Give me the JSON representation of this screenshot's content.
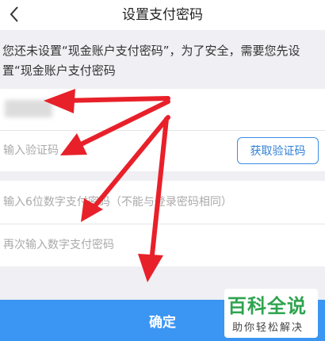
{
  "header": {
    "title": "设置支付密码",
    "back_icon": "chevron-left-icon"
  },
  "notice": {
    "text": "您还未设置“现金账户支付密码”，为了安全，需要您先设置“现金账户支付密码"
  },
  "form": {
    "phone": {
      "value": ""
    },
    "code": {
      "placeholder": "输入验证码",
      "button_label": "获取验证码"
    },
    "password": {
      "placeholder": "输入6位数字支付密码（不能与登录密码相同）"
    },
    "confirm_password": {
      "placeholder": "再次输入数字支付密码"
    }
  },
  "confirm_button": {
    "label": "确定"
  },
  "watermark": {
    "main": "百科全说",
    "sub": "助你轻松解决"
  },
  "colors": {
    "accent": "#3b95f2",
    "annotation_arrow": "#e8202a",
    "watermark_green": "#2ea44f"
  }
}
